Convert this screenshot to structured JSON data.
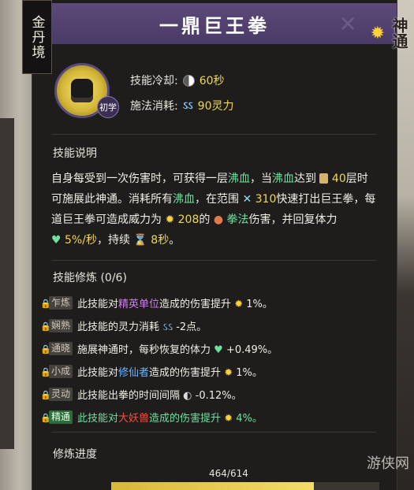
{
  "realm": "金丹境",
  "corner_logo": "神通",
  "skill": {
    "name": "一鼎巨王拳",
    "stage": "初学",
    "cooldown_label": "技能冷却:",
    "cooldown_value": "60秒",
    "cost_label": "施法消耗:",
    "cost_value": "90灵力"
  },
  "description": {
    "title": "技能说明",
    "line1_a": "自身每受到一次伤害时，可获得一层",
    "line1_hl1": "沸血",
    "line1_b": "，当",
    "line1_hl2": "沸血",
    "line1_c": "达到",
    "line1_num": "40",
    "line1_d": "层时",
    "line2_a": "可施展此神通。消耗所有",
    "line2_hl": "沸血",
    "line2_b": "，在范围",
    "line2_num": "310",
    "line2_c": "快速打出巨王拳，每",
    "line3_a": "道巨王拳可造成威力为",
    "line3_num": "208",
    "line3_b": "的",
    "line3_hl": "拳法",
    "line3_c": "伤害，并回复体力",
    "line4_num1": "5%/秒",
    "line4_a": "，持续",
    "line4_num2": "8秒",
    "line4_b": "。"
  },
  "cultivation": {
    "title": "技能修炼 (0/6)",
    "rows": [
      {
        "tag": "乍炼",
        "a": "此技能对",
        "hl": "精英单位",
        "hl_color": "purple",
        "b": "造成的伤害提升",
        "val": "1%。",
        "active": false
      },
      {
        "tag": "娴熟",
        "a": "此技能的灵力消耗",
        "hl": "",
        "hl_color": "",
        "b": "",
        "val": "-2点。",
        "active": false
      },
      {
        "tag": "通晓",
        "a": "施展神通时，每秒恢复的体力",
        "hl": "",
        "hl_color": "",
        "b": "",
        "val": "+0.49%。",
        "active": false
      },
      {
        "tag": "小成",
        "a": "此技能对",
        "hl": "修仙者",
        "hl_color": "blue",
        "b": "造成的伤害提升",
        "val": "1%。",
        "active": false
      },
      {
        "tag": "灵动",
        "a": "此技能出拳的时间间隔",
        "hl": "",
        "hl_color": "",
        "b": "",
        "val": "-0.12%。",
        "active": false
      },
      {
        "tag": "精通",
        "a": "此技能对",
        "hl": "大妖兽",
        "hl_color": "red",
        "b": "造成的伤害提升",
        "val": "4%。",
        "active": true
      }
    ]
  },
  "progress": {
    "label": "修炼进度",
    "text": "464/614",
    "value": 0.756
  },
  "watermark": "游侠网",
  "colors": {
    "title_bar": "#4f3f6b",
    "highlight_green": "#6fe0a0",
    "highlight_yellow": "#f0d84a"
  }
}
